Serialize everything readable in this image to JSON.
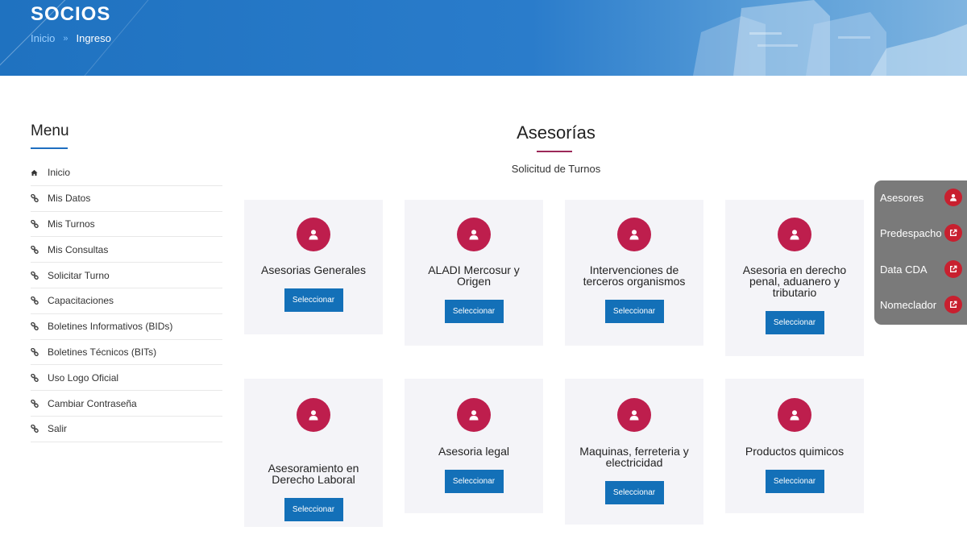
{
  "header": {
    "title": "SOCIOS",
    "breadcrumb": {
      "home": "Inicio",
      "current": "Ingreso"
    }
  },
  "menu": {
    "title": "Menu",
    "items": [
      {
        "label": "Inicio",
        "icon": "home-icon"
      },
      {
        "label": "Mis Datos",
        "icon": "link-icon"
      },
      {
        "label": "Mis Turnos",
        "icon": "link-icon"
      },
      {
        "label": "Mis Consultas",
        "icon": "link-icon"
      },
      {
        "label": "Solicitar Turno",
        "icon": "link-icon"
      },
      {
        "label": "Capacitaciones",
        "icon": "link-icon"
      },
      {
        "label": "Boletines Informativos (BIDs)",
        "icon": "link-icon"
      },
      {
        "label": "Boletines Técnicos (BITs)",
        "icon": "link-icon"
      },
      {
        "label": "Uso Logo Oficial",
        "icon": "link-icon"
      },
      {
        "label": "Cambiar Contraseña",
        "icon": "link-icon"
      },
      {
        "label": "Salir",
        "icon": "link-icon"
      }
    ]
  },
  "main": {
    "title": "Asesorías",
    "subtitle": "Solicitud de Turnos",
    "button_label": "Seleccionar",
    "cards": [
      {
        "title": "Asesorias Generales"
      },
      {
        "title": "ALADI Mercosur y Origen"
      },
      {
        "title": "Intervenciones de terceros organismos"
      },
      {
        "title": "Asesoria en derecho penal, aduanero y tributario"
      },
      {
        "title": "Asesoramiento en Derecho Laboral"
      },
      {
        "title": "Asesoria legal"
      },
      {
        "title": "Maquinas, ferreteria y electricidad"
      },
      {
        "title": "Productos quimicos"
      }
    ]
  },
  "side_panel": {
    "links": [
      {
        "label": "Asesores",
        "icon": "user-icon"
      },
      {
        "label": "Predespacho",
        "icon": "external-link-icon"
      },
      {
        "label": "Data CDA",
        "icon": "external-link-icon"
      },
      {
        "label": "Nomeclador",
        "icon": "external-link-icon"
      }
    ]
  },
  "colors": {
    "banner": "#2a7ccb",
    "accent": "#be1e4d",
    "button": "#1370b8",
    "panel": "#7a7a7a"
  }
}
